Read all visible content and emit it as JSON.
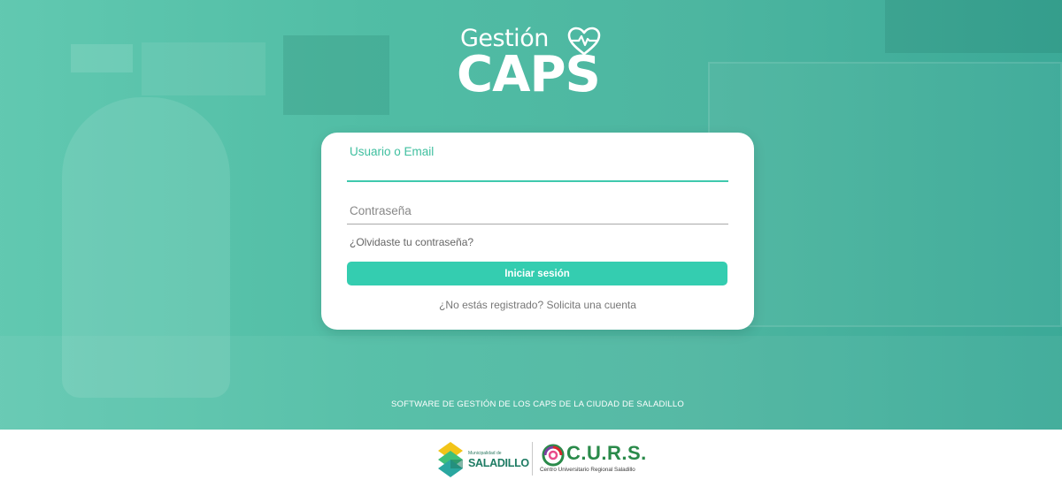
{
  "brand": {
    "logo_top": "Gestión",
    "logo_main": "CAPS"
  },
  "login_form": {
    "username_label": "Usuario o Email",
    "password_label": "Contraseña",
    "forgot_password": "¿Olvidaste tu contraseña?",
    "submit_label": "Iniciar sesión",
    "register_text": "¿No estás registrado? Solicita una cuenta"
  },
  "tagline": "SOFTWARE DE GESTIÓN DE LOS CAPS DE LA CIUDAD DE SALADILLO",
  "footer": {
    "muni_small": "Municipalidad de",
    "muni_name": "SALADILLO",
    "curs_name": "C.U.R.S.",
    "curs_sub": "Centro Universitario Regional Saladillo"
  },
  "colors": {
    "accent": "#34cdb0",
    "hero_bg": "#3fb89a"
  },
  "icons": {
    "heart": "heart-pulse-icon"
  }
}
